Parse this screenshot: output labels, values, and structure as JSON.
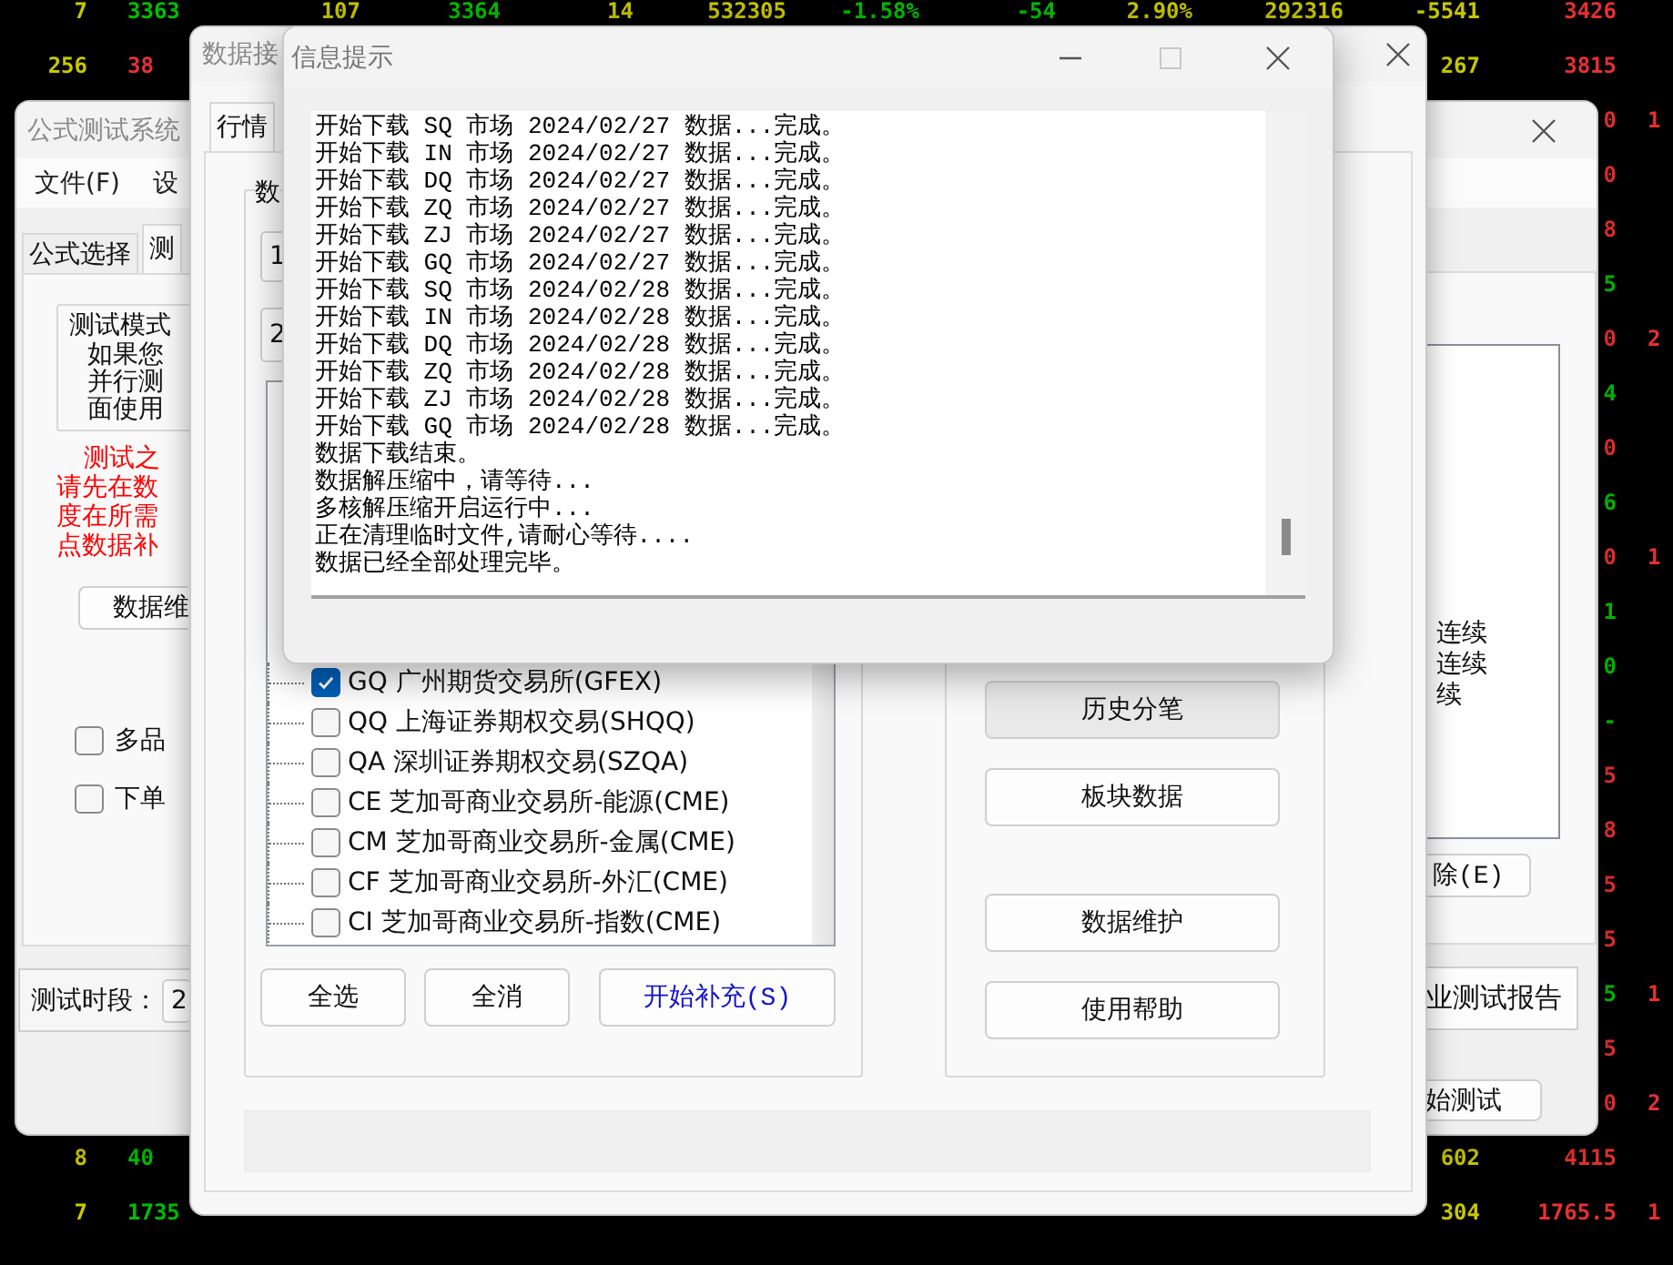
{
  "ticker": {
    "rows": [
      {
        "cells": [
          {
            "text": "7",
            "color": "#c8c800"
          },
          {
            "text": "3363",
            "color": "#00c000"
          },
          {
            "text": "107",
            "color": "#c8c800"
          },
          {
            "text": "3364",
            "color": "#00c000"
          },
          {
            "text": "14",
            "color": "#c8c800"
          },
          {
            "text": "532305",
            "color": "#c8c800"
          },
          {
            "text": "-1.58%",
            "color": "#00c000"
          },
          {
            "text": "-54",
            "color": "#00c000"
          },
          {
            "text": "2.90%",
            "color": "#c8c800"
          },
          {
            "text": "292316",
            "color": "#c8c800"
          },
          {
            "text": "-5541",
            "color": "#c8c800"
          },
          {
            "text": "3426",
            "color": "#e83030"
          },
          null
        ]
      },
      {
        "cells": [
          {
            "text": "256",
            "color": "#c8c800"
          },
          {
            "text": "38",
            "color": "#e83030"
          },
          null,
          null,
          null,
          null,
          null,
          null,
          null,
          null,
          {
            "text": "267",
            "color": "#c8c800"
          },
          {
            "text": "3815",
            "color": "#e83030"
          },
          null
        ]
      },
      {
        "cells": [
          null,
          null,
          null,
          null,
          null,
          null,
          null,
          null,
          null,
          null,
          null,
          {
            "text": "0",
            "color": "#e83030"
          },
          {
            "text": "1",
            "color": "#e83030"
          }
        ]
      },
      {
        "cells": [
          null,
          null,
          null,
          null,
          null,
          null,
          null,
          null,
          null,
          null,
          null,
          {
            "text": "0",
            "color": "#e83030"
          },
          null
        ]
      },
      {
        "cells": [
          null,
          null,
          null,
          null,
          null,
          null,
          null,
          null,
          null,
          null,
          null,
          {
            "text": "8",
            "color": "#e83030"
          },
          null
        ]
      },
      {
        "cells": [
          null,
          null,
          null,
          null,
          null,
          null,
          null,
          null,
          null,
          null,
          null,
          {
            "text": "5",
            "color": "#00c000"
          },
          null
        ]
      },
      {
        "cells": [
          null,
          null,
          null,
          null,
          null,
          null,
          null,
          null,
          null,
          null,
          null,
          {
            "text": "0",
            "color": "#e83030"
          },
          {
            "text": "2",
            "color": "#e83030"
          }
        ]
      },
      {
        "cells": [
          null,
          null,
          null,
          null,
          null,
          null,
          null,
          null,
          null,
          null,
          null,
          {
            "text": "4",
            "color": "#00c000"
          },
          null
        ]
      },
      {
        "cells": [
          null,
          null,
          null,
          null,
          null,
          null,
          null,
          null,
          null,
          null,
          null,
          {
            "text": "0",
            "color": "#e83030"
          },
          null
        ]
      },
      {
        "cells": [
          null,
          null,
          null,
          null,
          null,
          null,
          null,
          null,
          null,
          null,
          null,
          {
            "text": "6",
            "color": "#00c000"
          },
          null
        ]
      },
      {
        "cells": [
          null,
          null,
          null,
          null,
          null,
          null,
          null,
          null,
          null,
          null,
          null,
          {
            "text": "0",
            "color": "#e83030"
          },
          {
            "text": "1",
            "color": "#e83030"
          }
        ]
      },
      {
        "cells": [
          null,
          null,
          null,
          null,
          null,
          null,
          null,
          null,
          null,
          null,
          null,
          {
            "text": "1",
            "color": "#00c000"
          },
          null
        ]
      },
      {
        "cells": [
          null,
          null,
          null,
          null,
          null,
          null,
          null,
          null,
          null,
          null,
          null,
          {
            "text": "0",
            "color": "#00c000"
          },
          null
        ]
      },
      {
        "cells": [
          null,
          null,
          null,
          null,
          null,
          null,
          null,
          null,
          null,
          null,
          null,
          {
            "text": "-",
            "color": "#00c000"
          },
          null
        ]
      },
      {
        "cells": [
          null,
          null,
          null,
          null,
          null,
          null,
          null,
          null,
          null,
          null,
          null,
          {
            "text": "5",
            "color": "#e83030"
          },
          null
        ]
      },
      {
        "cells": [
          null,
          null,
          null,
          null,
          null,
          null,
          null,
          null,
          null,
          null,
          null,
          {
            "text": "8",
            "color": "#e83030"
          },
          null
        ]
      },
      {
        "cells": [
          null,
          null,
          null,
          null,
          null,
          null,
          null,
          null,
          null,
          null,
          null,
          {
            "text": "5",
            "color": "#e83030"
          },
          null
        ]
      },
      {
        "cells": [
          null,
          null,
          null,
          null,
          null,
          null,
          null,
          null,
          null,
          null,
          null,
          {
            "text": "5",
            "color": "#e83030"
          },
          null
        ]
      },
      {
        "cells": [
          null,
          null,
          null,
          null,
          null,
          null,
          null,
          null,
          null,
          null,
          null,
          {
            "text": "5",
            "color": "#00c000"
          },
          {
            "text": "1",
            "color": "#e83030"
          }
        ]
      },
      {
        "cells": [
          null,
          null,
          null,
          null,
          null,
          null,
          null,
          null,
          null,
          null,
          null,
          {
            "text": "5",
            "color": "#e83030"
          },
          null
        ]
      },
      {
        "cells": [
          null,
          null,
          null,
          null,
          null,
          null,
          null,
          null,
          null,
          null,
          null,
          {
            "text": "0",
            "color": "#e83030"
          },
          {
            "text": "2",
            "color": "#e83030"
          }
        ]
      },
      {
        "cells": [
          {
            "text": "8",
            "color": "#c8c800"
          },
          {
            "text": "40",
            "color": "#00c000"
          },
          null,
          null,
          null,
          null,
          null,
          null,
          null,
          null,
          {
            "text": "602",
            "color": "#c8c800"
          },
          {
            "text": "4115",
            "color": "#e83030"
          },
          null
        ]
      },
      {
        "cells": [
          {
            "text": "7",
            "color": "#c8c800"
          },
          {
            "text": "1735",
            "color": "#00c000"
          },
          null,
          null,
          null,
          null,
          null,
          null,
          null,
          null,
          {
            "text": "304",
            "color": "#c8c800"
          },
          {
            "text": "1765.5",
            "color": "#e83030"
          },
          {
            "text": "1",
            "color": "#e83030"
          }
        ]
      }
    ]
  },
  "back_window": {
    "title": "公式测试系统",
    "menu": [
      "文件(F)",
      "设"
    ],
    "tabs": [
      {
        "label": "公式选择",
        "selected": false
      },
      {
        "label": "测",
        "selected": true
      }
    ],
    "test_mode": {
      "legend": "测试模式",
      "lines": [
        "如果您",
        "并行测",
        "面使用"
      ]
    },
    "warning_lines": [
      "测试之",
      "请先在数",
      "度在所需",
      "点数据补"
    ],
    "maintain_button": "数据维",
    "options": [
      {
        "label": "多品",
        "checked": false
      },
      {
        "label": "下单",
        "checked": false
      }
    ],
    "period": {
      "label": "测试时段：",
      "value": "2"
    },
    "list_items": [
      "连续",
      "连续",
      "续"
    ],
    "delete_button": "除(E)",
    "report_button": "业测试报告",
    "start_button": "始测试"
  },
  "data_window": {
    "title": "数据接",
    "tab": {
      "label": "行情",
      "selected": true
    },
    "group_legend": "数",
    "fields": [
      "1",
      "2"
    ],
    "markets": [
      {
        "label": "GQ 广州期货交易所(GFEX)",
        "checked": true
      },
      {
        "label": "QQ 上海证券期权交易(SHQQ)",
        "checked": false
      },
      {
        "label": "QA 深圳证券期权交易(SZQA)",
        "checked": false
      },
      {
        "label": "CE 芝加哥商业交易所-能源(CME)",
        "checked": false
      },
      {
        "label": "CM 芝加哥商业交易所-金属(CME)",
        "checked": false
      },
      {
        "label": "CF 芝加哥商业交易所-外汇(CME)",
        "checked": false
      },
      {
        "label": "CI 芝加哥商业交易所-指数(CME)",
        "checked": false
      }
    ],
    "buttons": [
      {
        "label": "全选",
        "kind": "plain"
      },
      {
        "label": "全消",
        "kind": "plain"
      },
      {
        "label": "开始补充(S)",
        "kind": "primary"
      }
    ],
    "side_button_groups": [
      [
        {
          "label": "历史分笔",
          "highlighted": true
        },
        {
          "label": "板块数据",
          "highlighted": false
        }
      ],
      [
        {
          "label": "数据维护",
          "highlighted": false
        },
        {
          "label": "使用帮助",
          "highlighted": false
        }
      ]
    ]
  },
  "dialog": {
    "title": "信息提示",
    "log": [
      "开始下载 SQ 市场 2024/02/27 数据...完成。",
      "开始下载 IN 市场 2024/02/27 数据...完成。",
      "开始下载 DQ 市场 2024/02/27 数据...完成。",
      "开始下载 ZQ 市场 2024/02/27 数据...完成。",
      "开始下载 ZJ 市场 2024/02/27 数据...完成。",
      "开始下载 GQ 市场 2024/02/27 数据...完成。",
      "开始下载 SQ 市场 2024/02/28 数据...完成。",
      "开始下载 IN 市场 2024/02/28 数据...完成。",
      "开始下载 DQ 市场 2024/02/28 数据...完成。",
      "开始下载 ZQ 市场 2024/02/28 数据...完成。",
      "开始下载 ZJ 市场 2024/02/28 数据...完成。",
      "开始下载 GQ 市场 2024/02/28 数据...完成。",
      "数据下载结束。",
      "数据解压缩中，请等待...",
      "多核解压缩开启运行中...",
      "正在清理临时文件,请耐心等待....",
      "数据已经全部处理完毕。"
    ]
  }
}
